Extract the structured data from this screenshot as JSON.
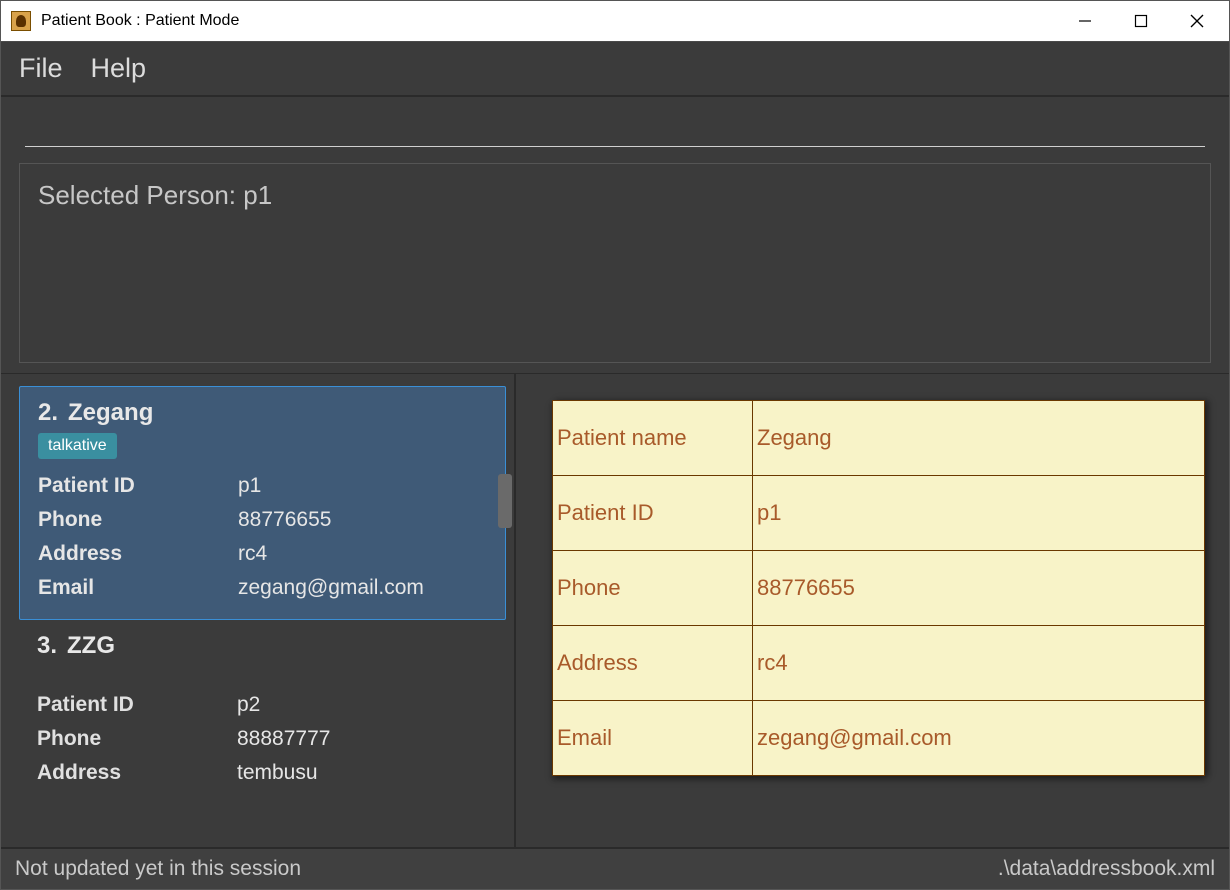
{
  "window": {
    "title": "Patient Book : Patient Mode"
  },
  "menu": {
    "file": "File",
    "help": "Help"
  },
  "command": {
    "value": ""
  },
  "result": {
    "text": "Selected Person: p1"
  },
  "list": {
    "items": [
      {
        "index": "2.",
        "name": "Zegang",
        "tag": "talkative",
        "patient_id_label": "Patient ID",
        "patient_id": "p1",
        "phone_label": "Phone",
        "phone": "88776655",
        "address_label": "Address",
        "address": "rc4",
        "email_label": "Email",
        "email": "zegang@gmail.com"
      },
      {
        "index": "3.",
        "name": "ZZG",
        "patient_id_label": "Patient ID",
        "patient_id": "p2",
        "phone_label": "Phone",
        "phone": "88887777",
        "address_label": "Address",
        "address": "tembusu"
      }
    ]
  },
  "detail": {
    "rows": [
      {
        "label": "Patient name",
        "value": "Zegang"
      },
      {
        "label": "Patient ID",
        "value": "p1"
      },
      {
        "label": "Phone",
        "value": "88776655"
      },
      {
        "label": "Address",
        "value": "rc4"
      },
      {
        "label": "Email",
        "value": "zegang@gmail.com"
      }
    ]
  },
  "status": {
    "left": "Not updated yet in this session",
    "right": ".\\data\\addressbook.xml"
  }
}
